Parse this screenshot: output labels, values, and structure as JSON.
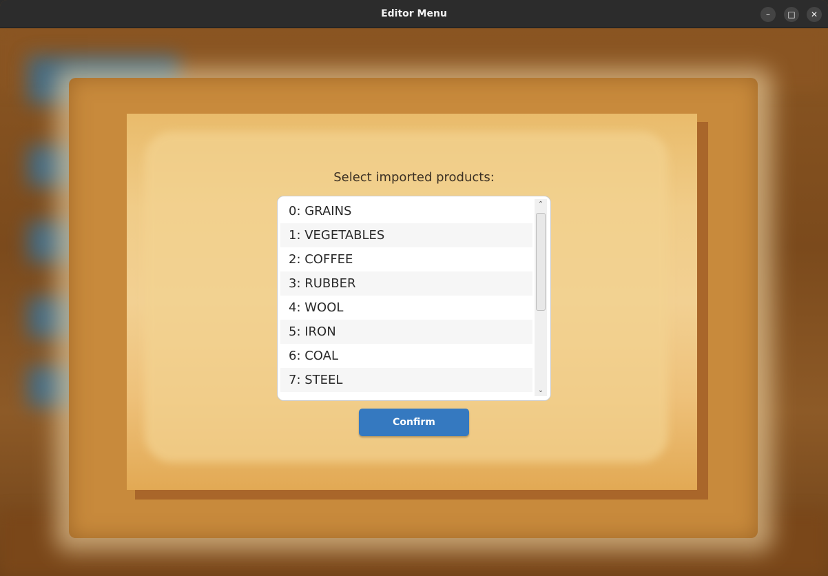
{
  "window": {
    "title": "Editor Menu",
    "controls": {
      "minimize_icon": "minimize-icon",
      "maximize_icon": "maximize-icon",
      "close_icon": "close-icon"
    }
  },
  "dialog": {
    "prompt": "Select imported products:",
    "products": [
      "0: GRAINS",
      "1: VEGETABLES",
      "2: COFFEE",
      "3: RUBBER",
      "4: WOOL",
      "5: IRON",
      "6: COAL",
      "7: STEEL"
    ],
    "confirm_label": "Confirm"
  },
  "colors": {
    "accent": "#3579c0",
    "parchment": "#f0cc88",
    "frame": "#c88a3c",
    "background_wood": "#7b4a1c"
  }
}
